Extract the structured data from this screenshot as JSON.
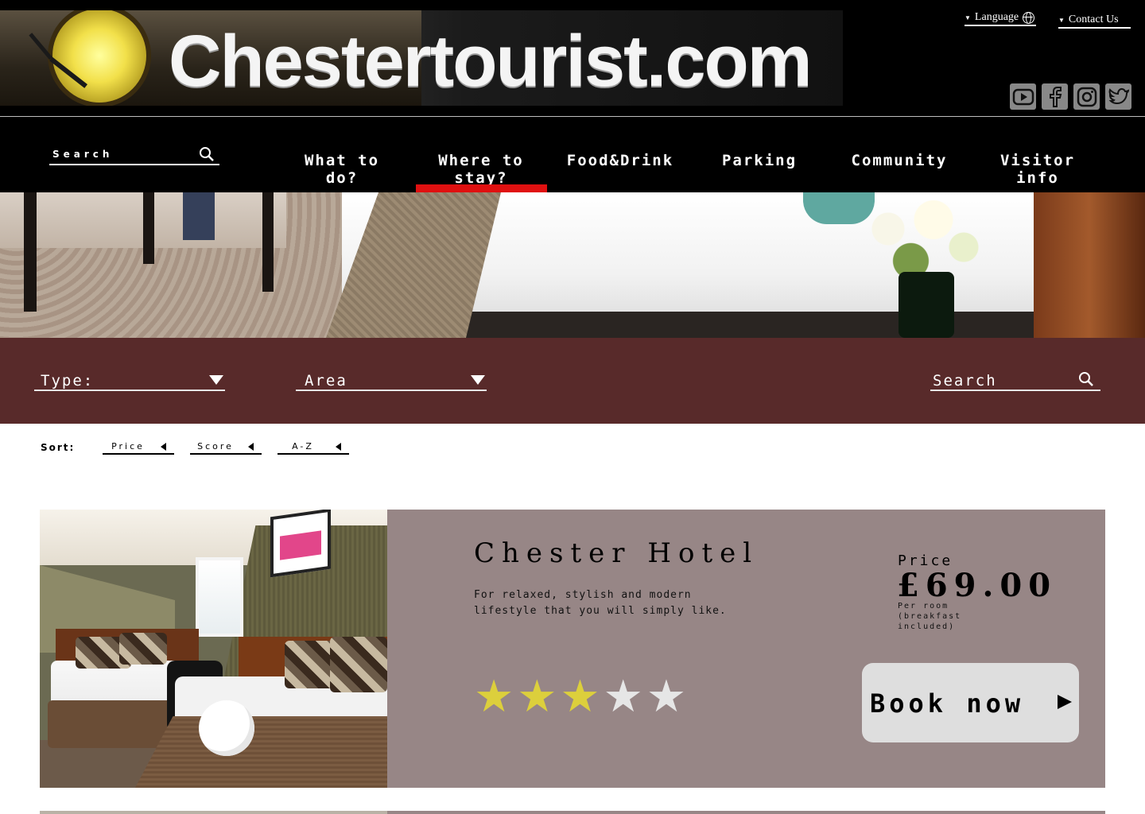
{
  "header": {
    "logo_text": "Chestertourist.com",
    "language_label": "Language",
    "contact_label": "Contact Us",
    "social": [
      "youtube-icon",
      "facebook-icon",
      "instagram-icon",
      "twitter-icon"
    ]
  },
  "nav": {
    "search_placeholder": "Search",
    "items": [
      {
        "label": "What to do?"
      },
      {
        "label": "Where to stay?",
        "active": true
      },
      {
        "label": "Food&Drink"
      },
      {
        "label": "Parking"
      },
      {
        "label": "Community"
      },
      {
        "label": "Visitor info"
      }
    ],
    "active_color": "#e01010"
  },
  "filters": {
    "type_label": "Type:",
    "area_label": "Area",
    "search_label": "Search",
    "band_color": "#582a2a"
  },
  "sort": {
    "label": "Sort:",
    "options": [
      "Price",
      "Score",
      "A-Z"
    ]
  },
  "hotels": [
    {
      "name": "Chester Hotel",
      "description": "For relaxed, stylish and modern lifestyle that you will simply like.",
      "rating": 3,
      "rating_max": 5,
      "price_label": "Price",
      "price": "£69.00",
      "price_note": "Per room (breakfast included)",
      "book_label": "Book now",
      "card_color": "#978686"
    }
  ]
}
